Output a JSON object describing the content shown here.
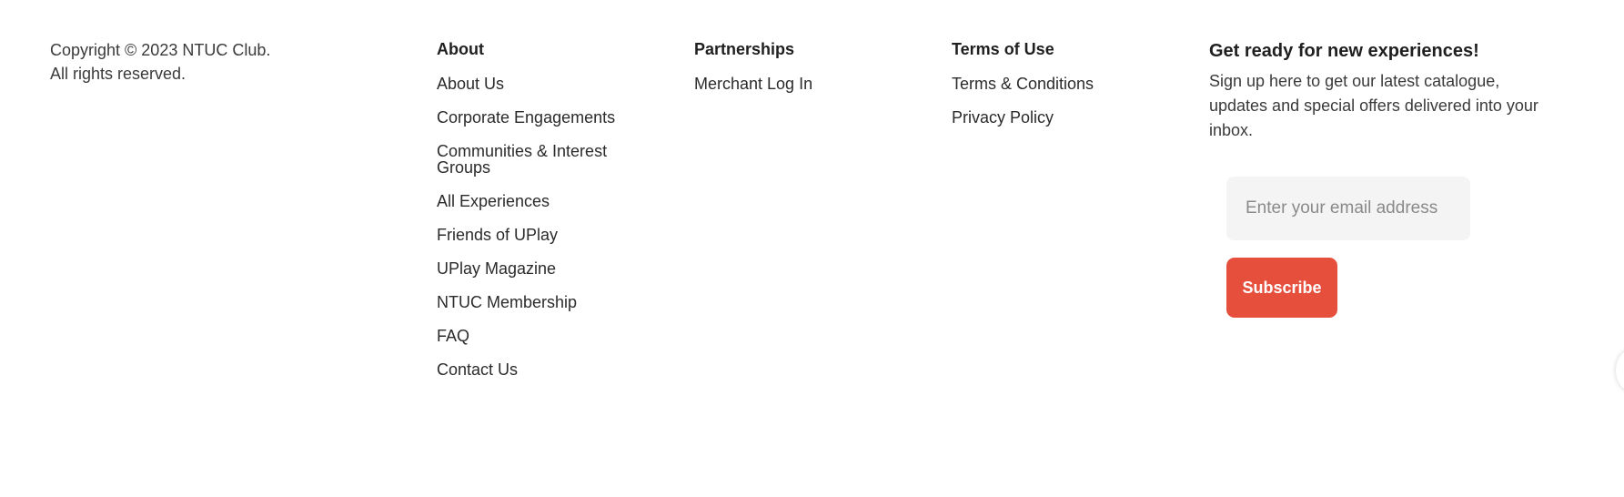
{
  "copyright": {
    "line1": "Copyright © 2023 NTUC Club.",
    "line2": "All rights reserved."
  },
  "about": {
    "heading": "About",
    "links": [
      "About Us",
      "Corporate Engagements",
      "Communities & Interest Groups",
      "All Experiences",
      "Friends of UPlay",
      "UPlay Magazine",
      "NTUC Membership",
      "FAQ",
      "Contact Us"
    ]
  },
  "partnerships": {
    "heading": "Partnerships",
    "links": [
      "Merchant Log In"
    ]
  },
  "terms": {
    "heading": "Terms of Use",
    "links": [
      "Terms & Conditions",
      "Privacy Policy"
    ]
  },
  "newsletter": {
    "title": "Get ready for new experiences!",
    "description": "Sign up here to get our latest catalogue, updates and special offers delivered into your inbox.",
    "email_placeholder": "Enter your email address",
    "subscribe_label": "Subscribe"
  },
  "colors": {
    "accent": "#e74f3d",
    "input_bg": "#f4f4f4",
    "text": "#2b2b2b"
  }
}
